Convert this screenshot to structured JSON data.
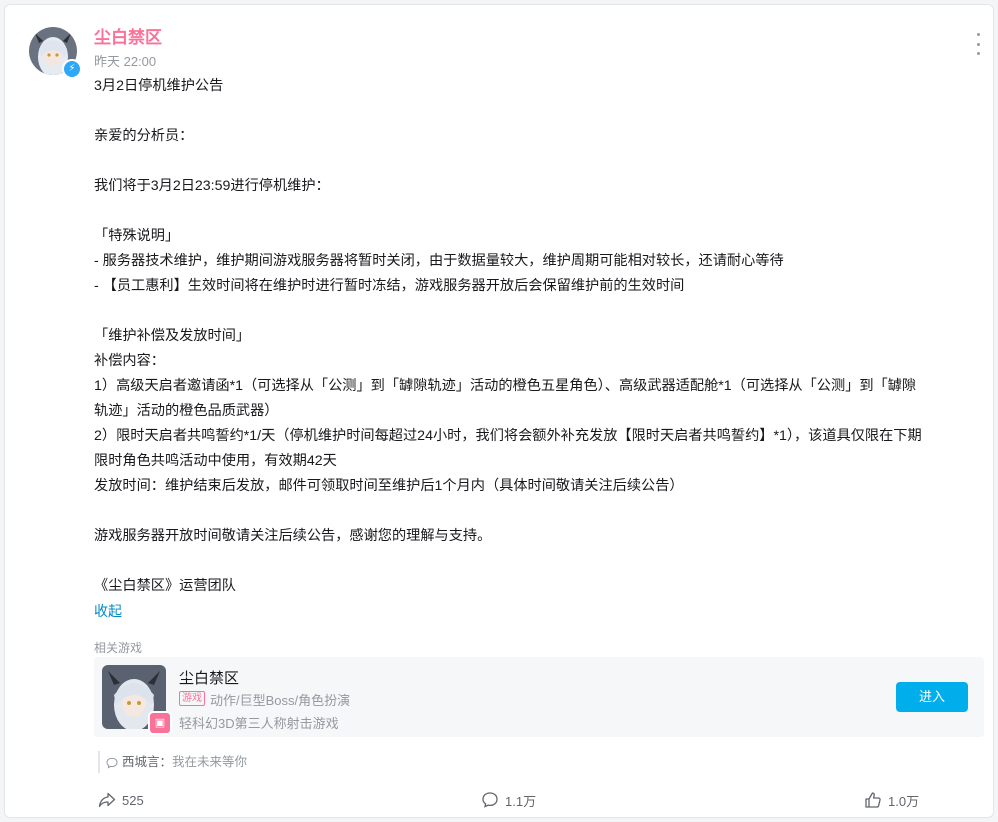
{
  "post": {
    "author": "尘白禁区",
    "time": "昨天 22:00",
    "lines": [
      "3月2日停机维护公告",
      "",
      "亲爱的分析员：",
      "",
      "我们将于3月2日23:59进行停机维护：",
      "",
      "「特殊说明」",
      "- 服务器技术维护，维护期间游戏服务器将暂时关闭，由于数据量较大，维护周期可能相对较长，还请耐心等待",
      "- 【员工惠利】生效时间将在维护时进行暂时冻结，游戏服务器开放后会保留维护前的生效时间",
      "",
      "「维护补偿及发放时间」",
      "补偿内容：",
      "1）高级天启者邀请函*1（可选择从「公测」到「罅隙轨迹」活动的橙色五星角色）、高级武器适配舱*1（可选择从「公测」到「罅隙",
      "轨迹」活动的橙色品质武器）",
      "2）限时天启者共鸣誓约*1/天（停机维护时间每超过24小时，我们将会额外补充发放【限时天启者共鸣誓约】*1），该道具仅限在下期",
      "限时角色共鸣活动中使用，有效期42天",
      "发放时间：维护结束后发放，邮件可领取时间至维护后1个月内（具体时间敬请关注后续公告）",
      "",
      "游戏服务器开放时间敬请关注后续公告，感谢您的理解与支持。",
      "",
      "《尘白禁区》运营团队"
    ],
    "collapse_label": "收起"
  },
  "related": {
    "label": "相关游戏",
    "game_title": "尘白禁区",
    "tag": "游戏",
    "genre": "动作/巨型Boss/角色扮演",
    "desc": "轻科幻3D第三人称射击游戏",
    "enter_label": "进入"
  },
  "comment_preview": {
    "user": "西城言：",
    "text": "我在未来等你"
  },
  "actions": {
    "forward_count": "525",
    "comment_count": "1.1万",
    "like_count": "1.0万"
  },
  "colors": {
    "author": "#fb7299",
    "link": "#008ac5",
    "button": "#00aeec"
  }
}
